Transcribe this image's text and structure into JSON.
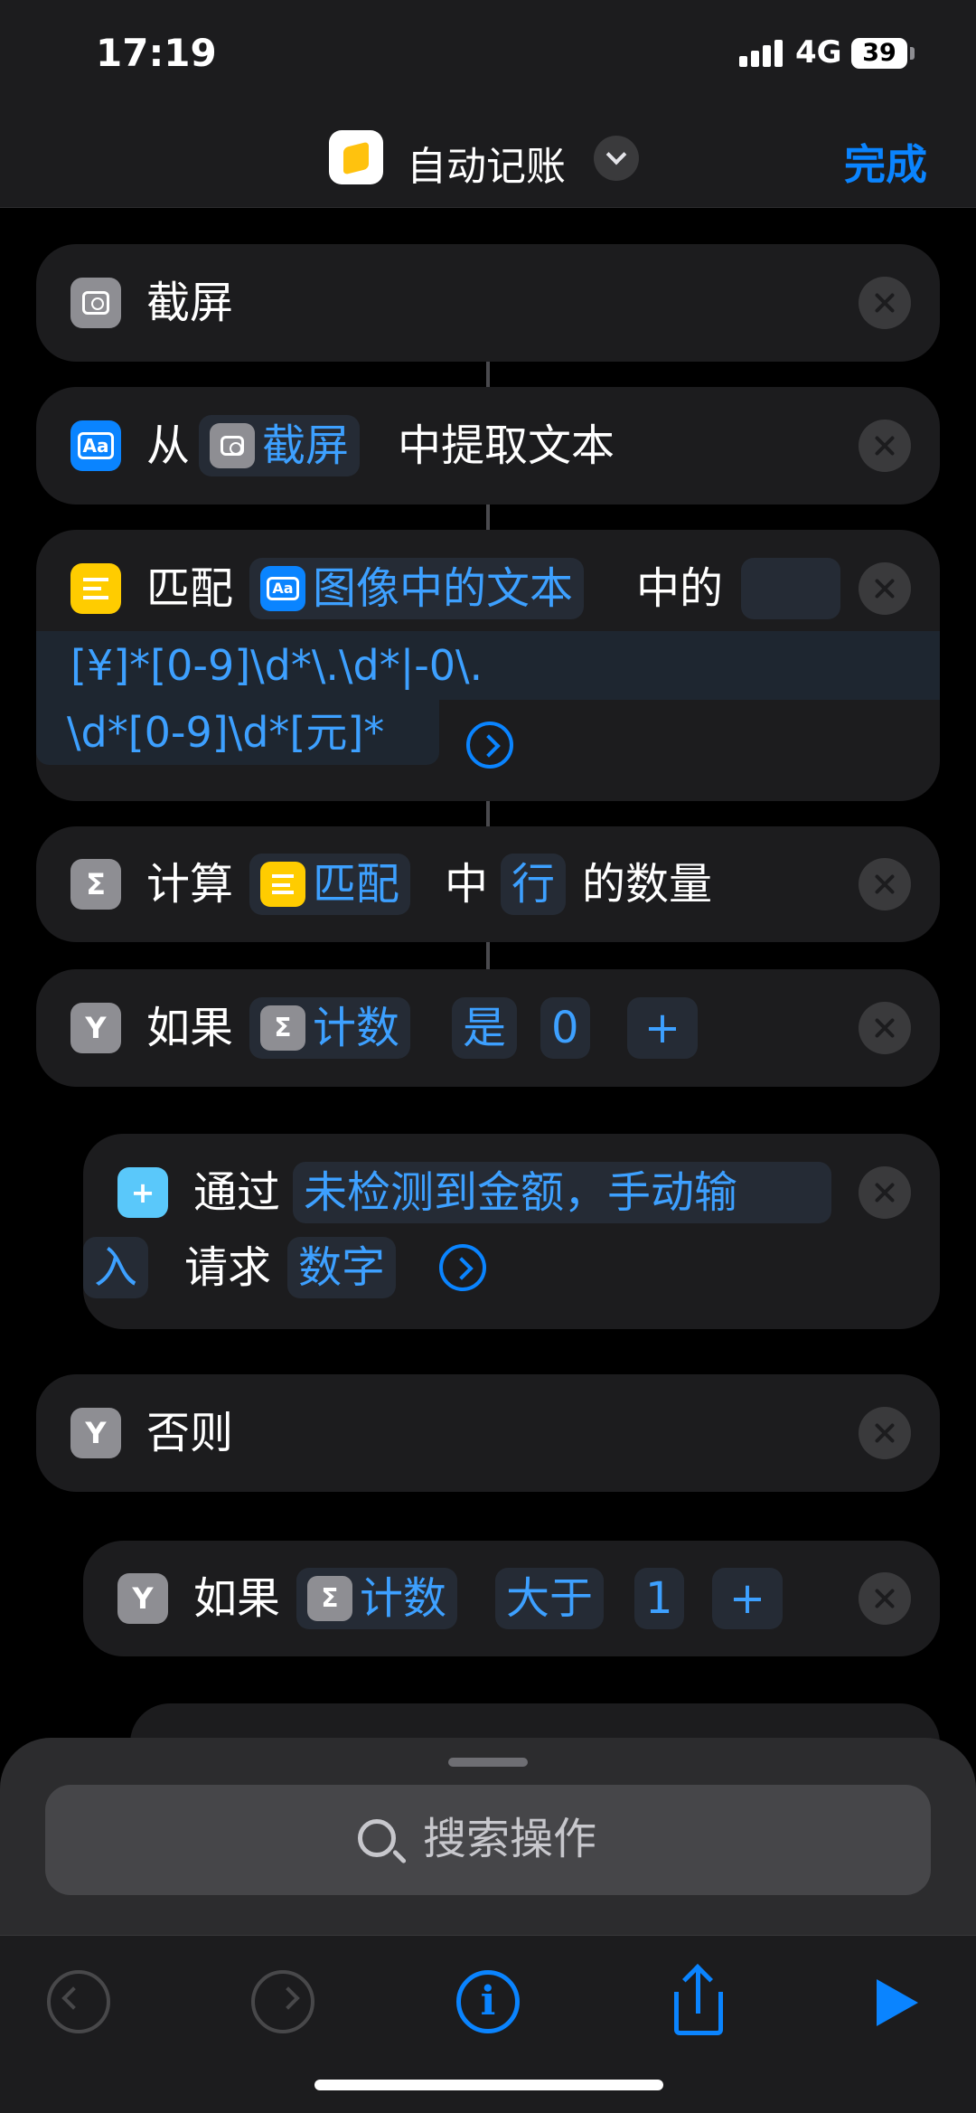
{
  "status_bar": {
    "time": "17:19",
    "network": "4G",
    "battery": "39"
  },
  "nav": {
    "title": "自动记账",
    "done_label": "完成"
  },
  "actions": {
    "screenshot": {
      "label": "截屏"
    },
    "extract": {
      "prefix": "从",
      "var": "截屏",
      "suffix": "中提取文本"
    },
    "match": {
      "prefix": "匹配",
      "var": "图像中的文本",
      "mid": "中的",
      "regex_line1": "[¥]*[0-9]\\d*\\.\\d*|-0\\.",
      "regex_line2": "\\d*[0-9]\\d*[元]*"
    },
    "count": {
      "prefix": "计算",
      "var": "匹配",
      "mid": "中",
      "unit": "行",
      "suffix": "的数量"
    },
    "if1": {
      "prefix": "如果",
      "var": "计数",
      "op": "是",
      "value": "0",
      "plus": "+"
    },
    "ask": {
      "prefix": "通过",
      "prompt_line1": "未检测到金额，手动输",
      "prompt_line2": "入",
      "mid": "请求",
      "type": "数字"
    },
    "otherwise": {
      "label": "否则"
    },
    "if2": {
      "prefix": "如果",
      "var": "计数",
      "op": "大于",
      "value": "1",
      "plus": "+"
    }
  },
  "sheet": {
    "search_placeholder": "搜索操作"
  },
  "icons": {
    "screenshot": "screenshot-icon",
    "text": "text-icon",
    "match": "match-icon",
    "calc": "calculate-icon",
    "if": "if-icon",
    "ask": "ask-input-icon",
    "close": "close-icon"
  },
  "colors": {
    "accent": "#0a84ff",
    "card": "#1c1c1e",
    "background": "#000000"
  }
}
